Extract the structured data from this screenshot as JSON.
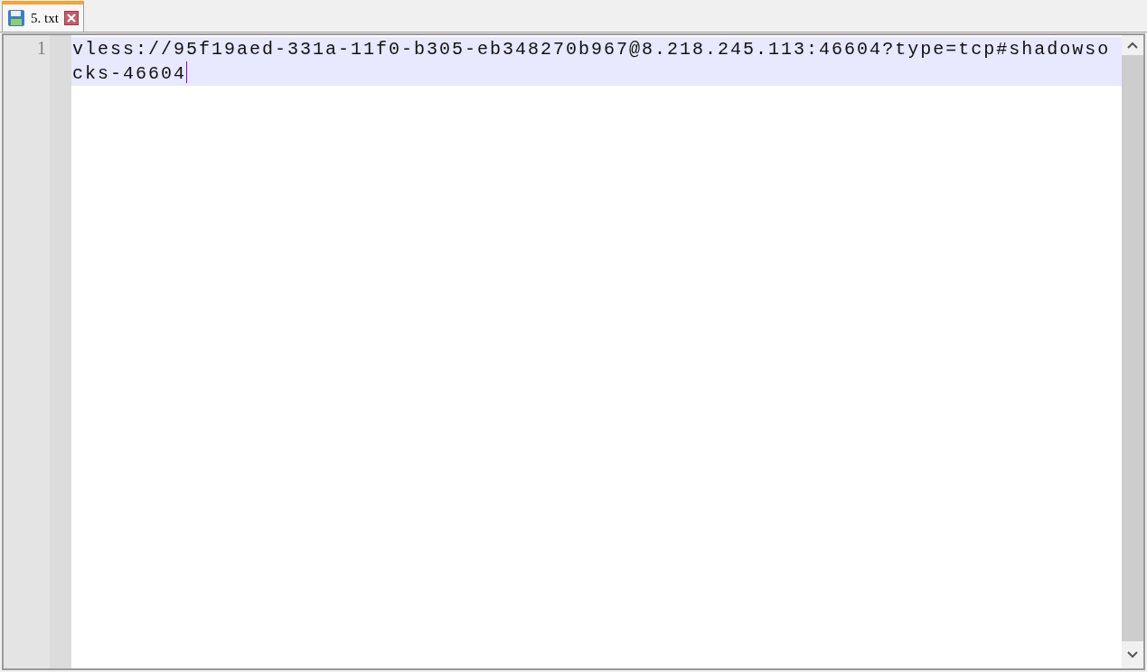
{
  "tabs": [
    {
      "label": "5. txt",
      "selected": true
    }
  ],
  "lines": [
    {
      "number": "1",
      "text": "vless://95f19aed-331a-11f0-b305-eb348270b967@8.218.245.113:46604?type=tcp#shadowsocks-46604",
      "current": true
    }
  ]
}
